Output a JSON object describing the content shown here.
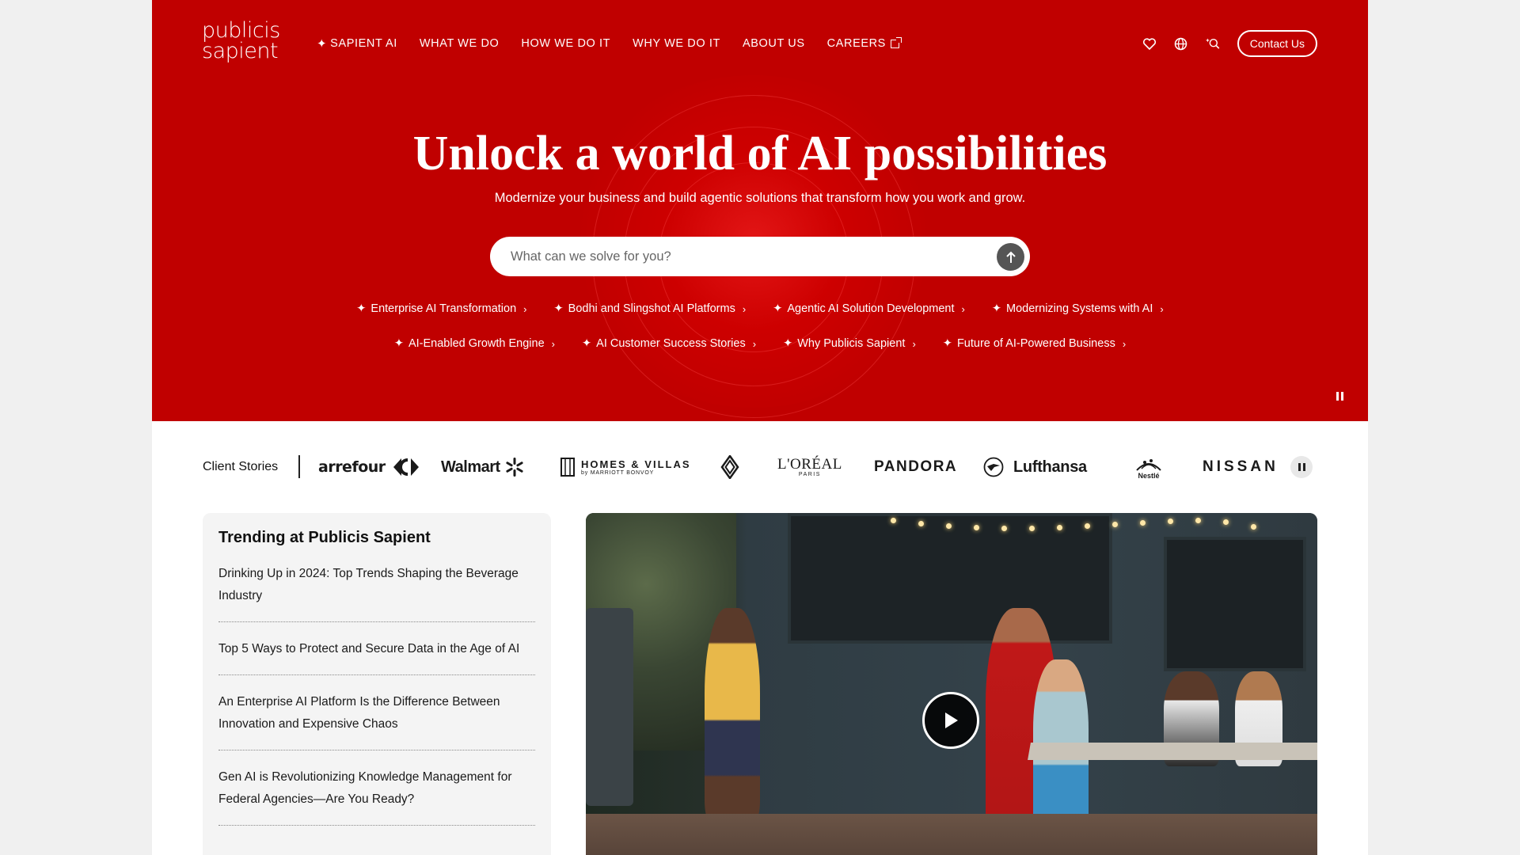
{
  "brand": {
    "line1": "publicis",
    "line2": "sapient"
  },
  "nav": {
    "items": [
      {
        "label": "SAPIENT AI",
        "spark": "✦"
      },
      {
        "label": "WHAT WE DO"
      },
      {
        "label": "HOW WE DO IT"
      },
      {
        "label": "WHY WE DO IT"
      },
      {
        "label": "ABOUT US"
      },
      {
        "label": "CAREERS"
      }
    ]
  },
  "utility": {
    "icons": [
      "heart-icon",
      "globe-icon",
      "ai-search-icon"
    ],
    "contact_label": "Contact Us"
  },
  "hero": {
    "title": "Unlock a world of AI possibilities",
    "subtitle": "Modernize your business and build agentic solutions that transform how you work and grow.",
    "search_placeholder": "What can we solve for you?",
    "chips_row1": [
      "Enterprise AI Transformation",
      "Bodhi and Slingshot AI Platforms",
      "Agentic AI Solution Development",
      "Modernizing Systems with AI"
    ],
    "chips_row2": [
      "AI-Enabled Growth Engine",
      "AI Customer Success Stories",
      "Why Publicis Sapient",
      "Future of AI-Powered Business"
    ],
    "spark": "✦",
    "chevron": "›",
    "bg_color": "#c00000"
  },
  "clients": {
    "label": "Client Stories",
    "logos": {
      "carrefour": "arrefour",
      "walmart": "Walmart",
      "homes_villas_line1": "HOMES & VILLAS",
      "homes_villas_line2": "by MARRIOTT BONVOY",
      "loreal": "L'ORÉAL",
      "loreal_sub": "PARIS",
      "pandora": "PANDORA",
      "lufthansa": "Lufthansa",
      "nestle": "Nestlé",
      "nissan": "NISSAN"
    }
  },
  "trending": {
    "title": "Trending at Publicis Sapient",
    "items": [
      "Drinking Up in 2024: Top Trends Shaping the Beverage Industry",
      "Top 5 Ways to Protect and Secure Data in the Age of AI",
      "An Enterprise AI Platform Is the Difference Between Innovation and Expensive Chaos",
      "Gen AI is Revolutionizing Knowledge Management for Federal Agencies—Are You Ready?"
    ]
  }
}
